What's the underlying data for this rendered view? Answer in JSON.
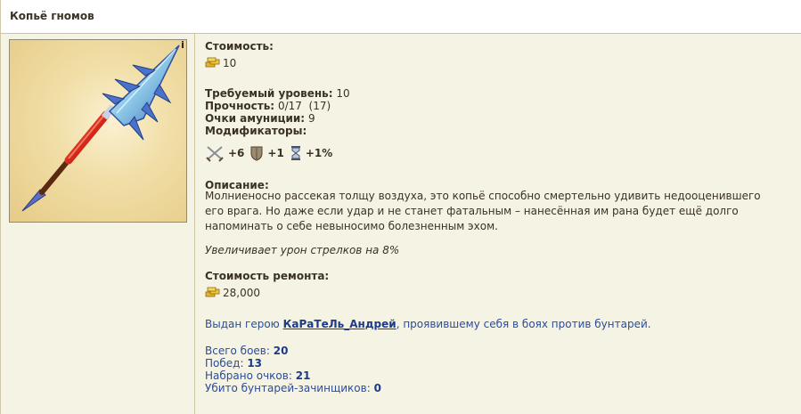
{
  "header": {
    "title": "Копьё гномов"
  },
  "item": {
    "info_mark": "i",
    "cost_label": "Стоимость:",
    "cost_value": "10",
    "level_label": "Требуемый уровень:",
    "level_value": "10",
    "durability_label": "Прочность:",
    "durability_value": "0/17  (17)",
    "ammo_label": "Очки амуниции:",
    "ammo_value": "9",
    "modifiers_label": "Модификаторы:",
    "modifiers": [
      {
        "icon": "crossed-swords-icon",
        "value": "+6"
      },
      {
        "icon": "shield-icon",
        "value": "+1"
      },
      {
        "icon": "hourglass-icon",
        "value": "+1%"
      }
    ],
    "description_label": "Описание:",
    "description_line1": "Молниеносно рассекая толщу воздуха, это копьё способно смертельно удивить недооценившего",
    "description_line2": "его врага. Но даже если удар и не станет фатальным – нанесённая им рана будет ещё долго",
    "description_line3": "напоминать о себе невыносимо болезненным эхом.",
    "bonus_text": "Увеличивает урон стрелков на 8%",
    "repair_label": "Стоимость ремонта:",
    "repair_value": "28,000",
    "issued_prefix": "Выдан герою",
    "issued_hero": "КаРаТеЛь_Андрей",
    "issued_suffix": ", проявившему себя в боях против бунтарей.",
    "stats": [
      {
        "label": "Всего боев:",
        "value": "20"
      },
      {
        "label": "Побед:",
        "value": "13"
      },
      {
        "label": "Набрано очков:",
        "value": "21"
      },
      {
        "label": "Убито бунтарей-зачинщиков:",
        "value": "0"
      }
    ]
  },
  "colors": {
    "background": "#f5f3e4",
    "link": "#1d3a8a",
    "text": "#3a3226",
    "gold": "#e2b52c"
  }
}
